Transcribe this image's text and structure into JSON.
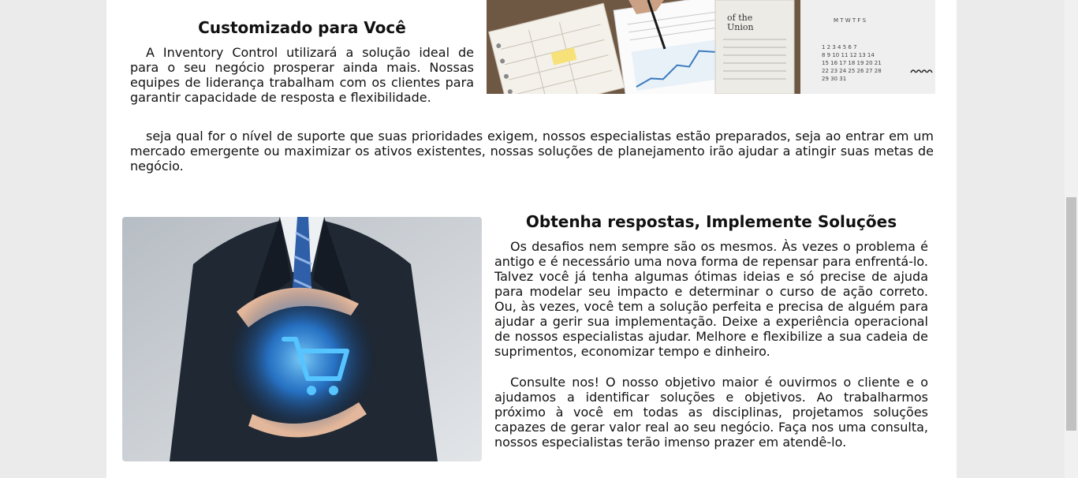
{
  "section1": {
    "title": "Customizado para Você",
    "text": "A Inventory Control utilizará a solução ideal de para o seu negócio prosperar ainda mais. Nossas equipes de liderança trabalham com os clientes para garantir capacidade de resposta e flexibilidade.",
    "image": {
      "description_icon": "business-charts-photo",
      "printed_text": [
        "of the",
        "Union"
      ]
    }
  },
  "wide_paragraph": "seja qual for o nível de suporte que suas prioridades exigem, nossos especialistas estão preparados, seja ao entrar em um mercado emergente ou maximizar os ativos existentes, nossas soluções de planejamento irão ajudar a atingir suas metas de negócio.",
  "section2": {
    "title": "Obtenha respostas, Implemente Soluções",
    "paragraph1": "Os desafios nem sempre são os mesmos. Às vezes o problema é antigo e é necessário uma nova forma de repensar para enfrentá-lo. Talvez você já tenha algumas ótimas ideias e só precise de ajuda para modelar seu impacto e determinar o curso de ação correto. Ou, às vezes, você tem a solução perfeita e precisa de alguém para ajudar a gerir sua implementação. Deixe a experiência operacional de nossos especialistas ajudar. Melhore e flexibilize a sua cadeia de suprimentos, economizar tempo e dinheiro.",
    "paragraph2": "Consulte nos! O nosso objetivo maior é ouvirmos o cliente e o ajudamos a identificar soluções e objetivos. Ao trabalharmos próximo à você em todas as disciplinas, projetamos soluções capazes de gerar valor real ao seu negócio. Faça nos uma consulta, nossos especialistas terão imenso prazer em atendê-lo.",
    "image": {
      "description_icon": "businessman-cart-photo"
    }
  },
  "colors": {
    "page_bg": "#ebebeb",
    "content_bg": "#ffffff",
    "text": "#111111",
    "cart_glow": "#2a8fff"
  }
}
